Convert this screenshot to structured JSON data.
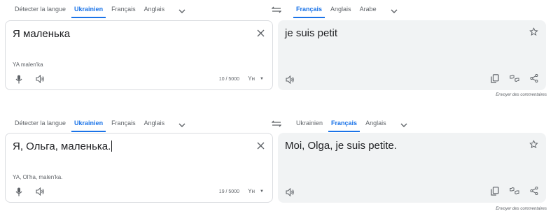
{
  "panels": [
    {
      "source_langs": [
        "Détecter la langue",
        "Ukrainien",
        "Français",
        "Anglais"
      ],
      "source_active": 1,
      "target_langs": [
        "Français",
        "Anglais",
        "Arabe"
      ],
      "target_active": 0,
      "source_text": "Я маленька",
      "transliteration": "YA malen'ka",
      "char_count": "10 / 5000",
      "ime_label": "Yн",
      "translation": "je suis petit",
      "feedback": "Envoyer des commentaires"
    },
    {
      "source_langs": [
        "Détecter la langue",
        "Ukrainien",
        "Français",
        "Anglais"
      ],
      "source_active": 1,
      "target_langs": [
        "Ukrainien",
        "Français",
        "Anglais"
      ],
      "target_active": 1,
      "source_text": "Я, Ольга, маленька.",
      "transliteration": "YA, Ol'ha, malen'ka.",
      "char_count": "19 / 5000",
      "ime_label": "Yн",
      "translation": "Moi, Olga, je suis petite.",
      "feedback": "Envoyer des commentaires"
    }
  ],
  "icons": {
    "dropdown": "chevron-down-icon",
    "swap": "swap-languages-icon",
    "clear": "close-icon",
    "mic": "microphone-icon",
    "speaker": "speaker-icon",
    "star": "star-outline-icon",
    "copy": "copy-icon",
    "rate": "thumbs-rating-icon",
    "share": "share-icon"
  },
  "colors": {
    "accent": "#1a73e8",
    "target_bg": "#f1f3f4",
    "muted": "#5f6368"
  }
}
